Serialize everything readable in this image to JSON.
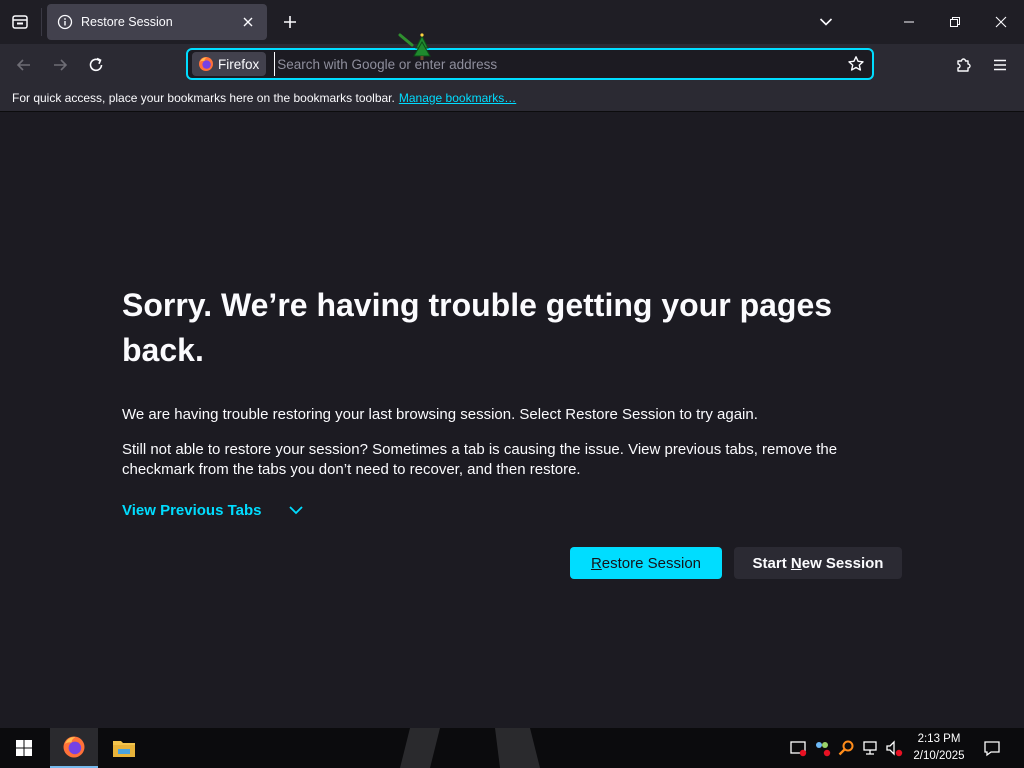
{
  "browser": {
    "tab_title": "Restore Session",
    "identity_label": "Firefox",
    "url_placeholder": "Search with Google or enter address",
    "url_value": ""
  },
  "bookmarks_bar": {
    "message": "For quick access, place your bookmarks here on the bookmarks toolbar.",
    "manage_link": "Manage bookmarks…"
  },
  "page": {
    "title": "Sorry. We’re having trouble getting your pages back.",
    "paragraph1": "We are having trouble restoring your last browsing session. Select Restore Session to try again.",
    "paragraph2": "Still not able to restore your session? Sometimes a tab is causing the issue. View previous tabs, remove the checkmark from the tabs you don’t need to recover, and then restore.",
    "view_previous_tabs": "View Previous Tabs",
    "restore_button": {
      "mnemonic": "R",
      "rest": "estore Session"
    },
    "new_session_button": {
      "before": "Start ",
      "mnemonic": "N",
      "after": "ew Session"
    }
  },
  "taskbar": {
    "time": "2:13 PM",
    "date": "2/10/2025"
  },
  "colors": {
    "accent": "#00ddff",
    "page_bg": "#1c1b22",
    "toolbar_bg": "#2b2a33",
    "tab_bg": "#42414d",
    "taskbar_bg": "#0b0b0d"
  },
  "icons": {
    "tab": "info-icon",
    "tab_close": "close-icon",
    "new_tab": "plus-icon",
    "back": "back-arrow-icon",
    "forward": "forward-arrow-icon",
    "reload": "reload-icon",
    "bookmark": "star-icon",
    "extensions": "puzzle-icon",
    "menu": "hamburger-menu-icon"
  }
}
